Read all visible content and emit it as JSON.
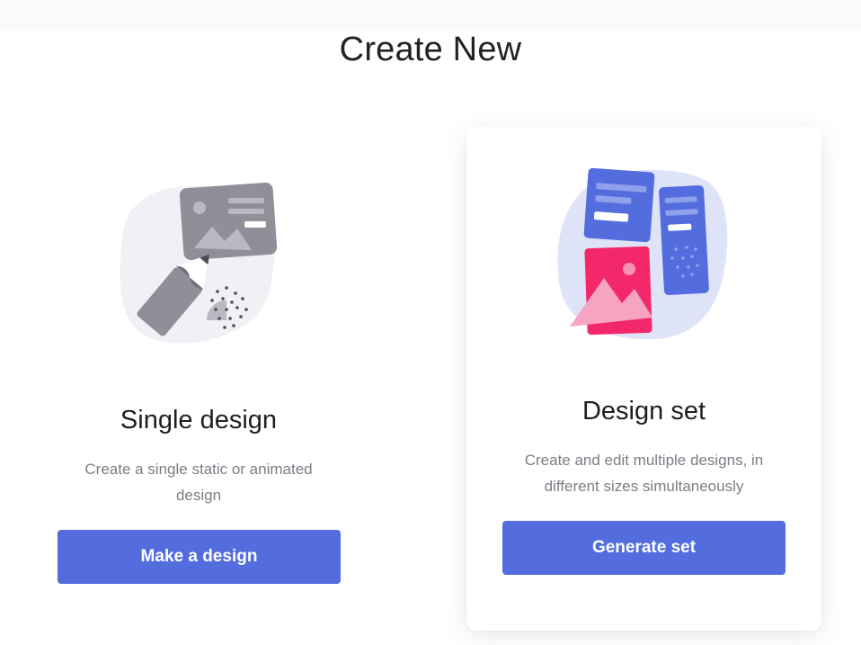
{
  "header": {
    "title": "Create New"
  },
  "options": [
    {
      "title": "Single design",
      "description": "Create a single static or animated design",
      "button_label": "Make a design",
      "icon": "pencil-and-image-illustration"
    },
    {
      "title": "Design set",
      "description": "Create and edit multiple designs, in different sizes simultaneously",
      "button_label": "Generate set",
      "icon": "multiple-designs-illustration"
    }
  ],
  "colors": {
    "accent": "#536ddf",
    "pink": "#f2286a",
    "soft_blue": "#dfe3f8",
    "gray_illustration": "#8e8f98"
  }
}
